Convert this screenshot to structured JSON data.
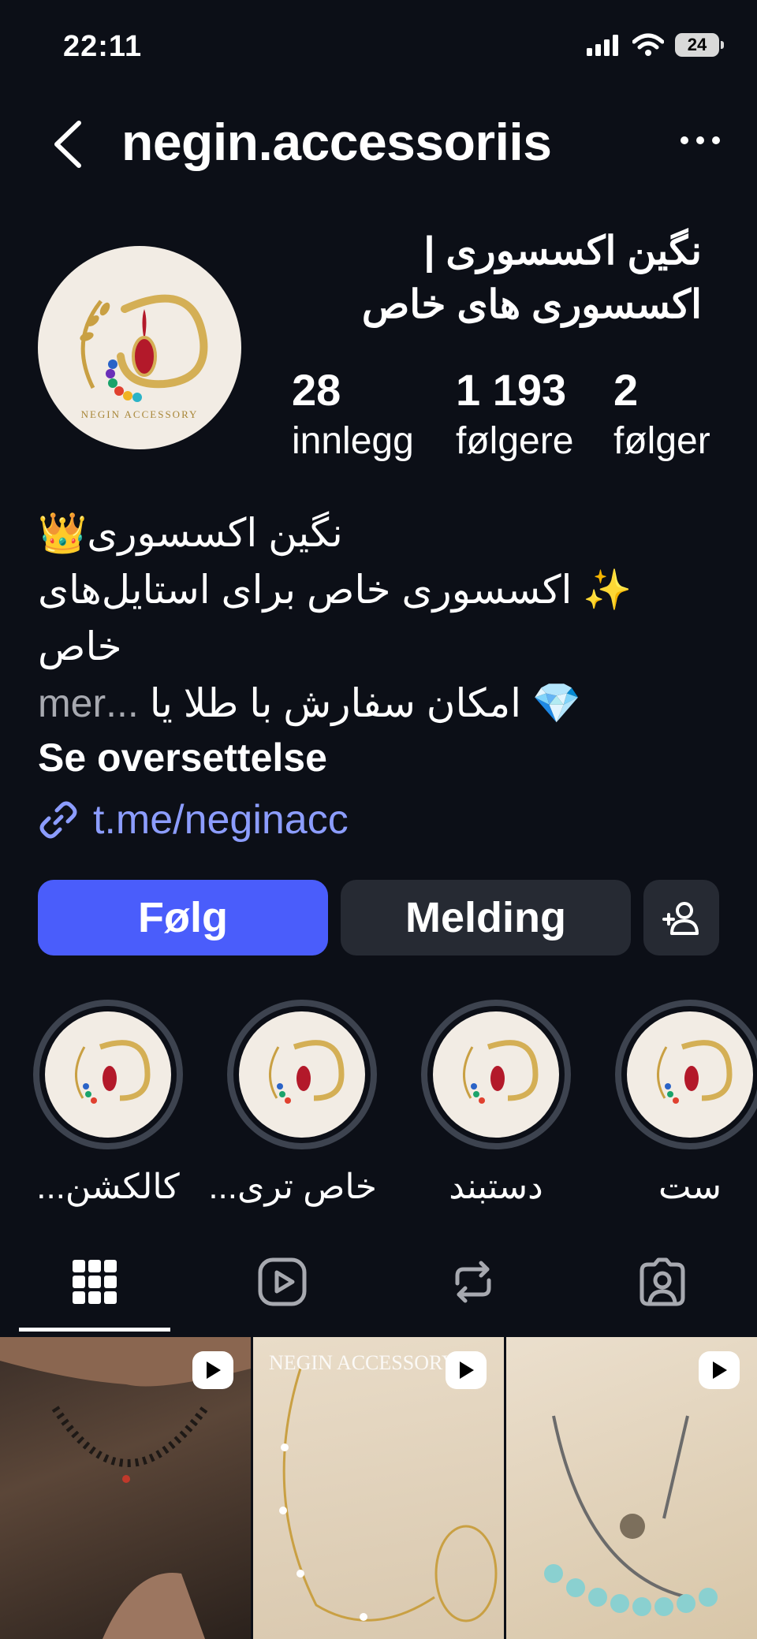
{
  "status_bar": {
    "time": "22:11",
    "battery": "24"
  },
  "header": {
    "username": "negin.accessoriis"
  },
  "profile": {
    "name_line1": "نگین اکسسوری |",
    "name_line2": "اکسسوری های خاص",
    "logo_text": "NEGIN ACCESSORY",
    "stats": [
      {
        "value": "28",
        "label": "innlegg"
      },
      {
        "value": "1 193",
        "label": "følgere"
      },
      {
        "value": "2",
        "label": "følger"
      }
    ]
  },
  "bio": {
    "line1": "نگین اکسسوری👑",
    "line2": "✨ اکسسوری خاص برای استایل‌های",
    "line3": "خاص",
    "line4": "💎 امکان سفارش با طلا یا",
    "more_label": "...mer",
    "translate_label": "Se oversettelse",
    "link": "t.me/neginacc"
  },
  "actions": {
    "follow_label": "Følg",
    "message_label": "Melding"
  },
  "highlights": [
    {
      "label": "کالکشن..."
    },
    {
      "label": "خاص تری..."
    },
    {
      "label": "دستبند"
    },
    {
      "label": "ست"
    }
  ],
  "tabs": [
    "grid-icon",
    "reels-icon",
    "reposts-icon",
    "tagged-icon"
  ],
  "grid": {
    "watermark": "NEGIN ACCESSORY"
  },
  "colors": {
    "background": "#0c0f17",
    "accent": "#4a5dfb",
    "secondary_button": "#262a33",
    "link": "#8c9dff"
  }
}
